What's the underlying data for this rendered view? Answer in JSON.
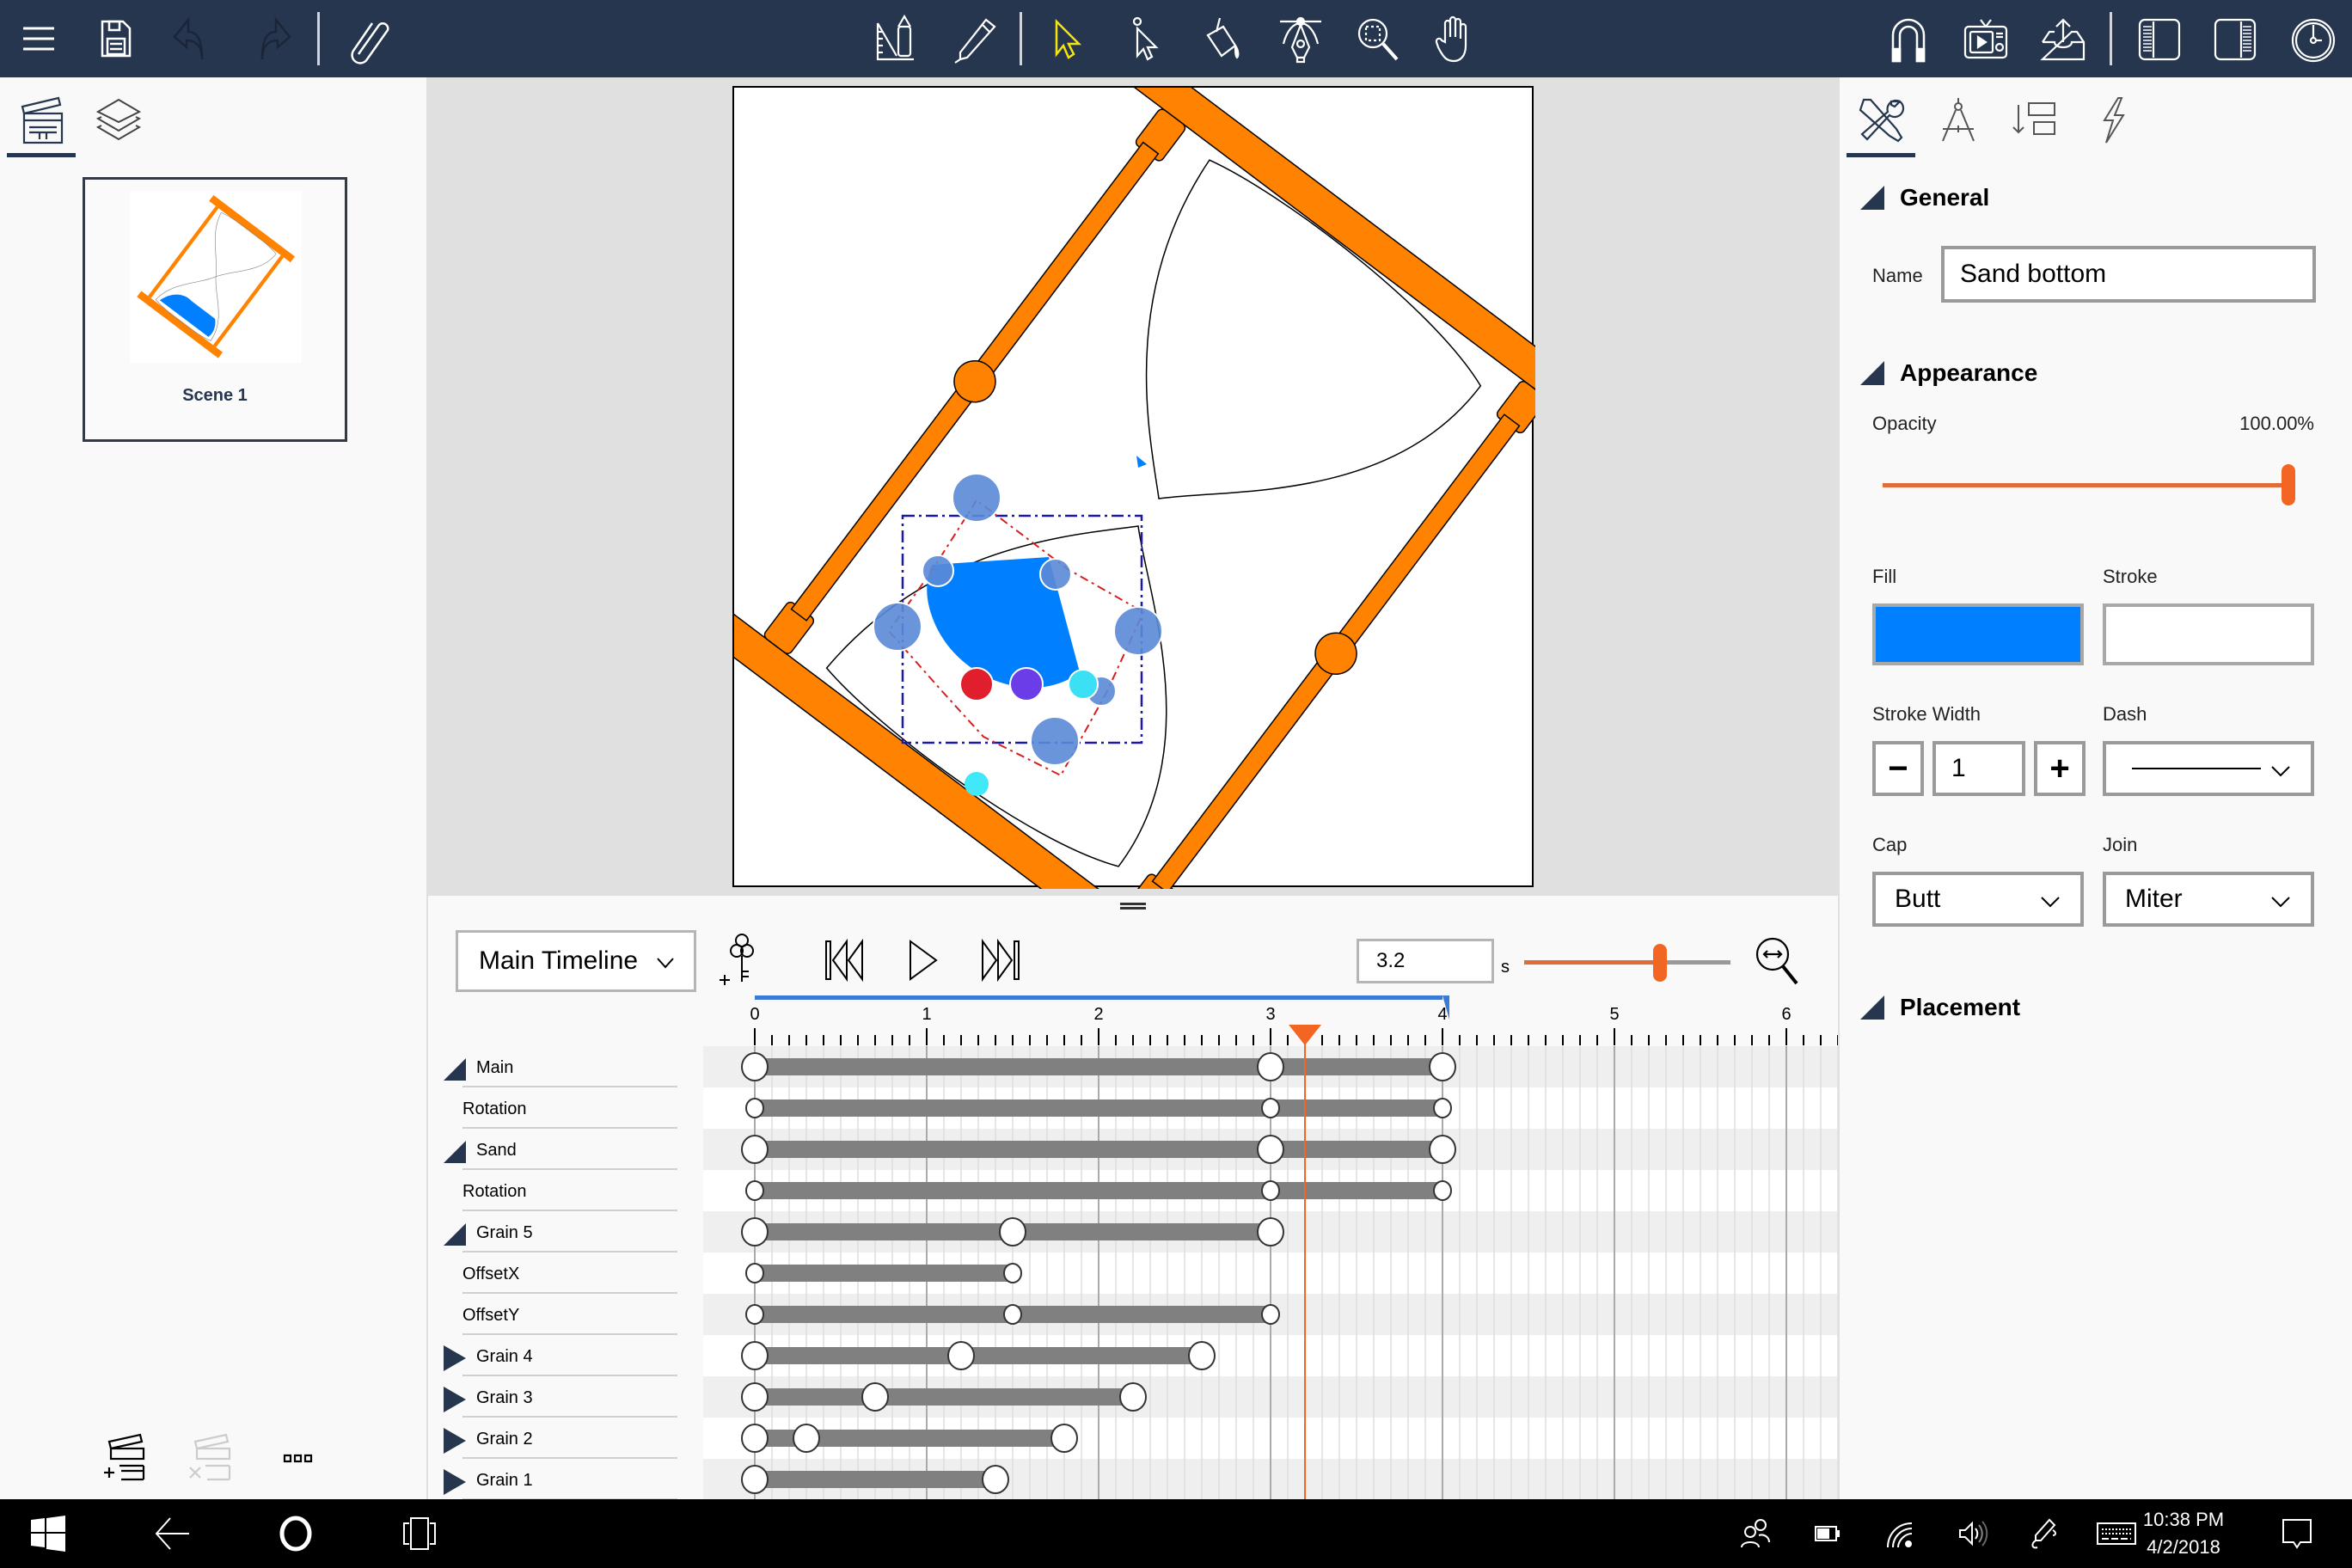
{
  "toolbar": {
    "left_icons": [
      "menu-icon",
      "save-icon",
      "undo-icon",
      "redo-icon",
      "attach-icon"
    ],
    "center_icons": [
      "design-tools-icon",
      "pen-icon",
      "select-icon",
      "direct-select-icon",
      "fill-bucket-icon",
      "bezier-pen-icon",
      "zoom-select-icon",
      "pan-hand-icon"
    ],
    "right_icons": [
      "magnet-snap-icon",
      "preview-tv-icon",
      "export-icon",
      "left-panel-toggle-icon",
      "right-panel-toggle-icon",
      "timeline-clock-icon"
    ],
    "active_tool": "select",
    "active_tool_color": "#f5e50a"
  },
  "left_panel": {
    "tabs": [
      "scenes",
      "layers"
    ],
    "active_tab": "scenes",
    "scenes": [
      {
        "label": "Scene 1"
      }
    ],
    "bottom_actions": [
      "add-scene",
      "delete-scene",
      "more"
    ],
    "more_label": "▫▫▫"
  },
  "canvas": {
    "selected_object": "Sand bottom",
    "colors": {
      "frame": "#ff8200",
      "sand": "#0080ff",
      "handle": "#5b8ad6",
      "grain_red": "#e01e2e",
      "grain_purple": "#6a3de8",
      "grain_cyan": "#3ce0f5",
      "selection_box": "#1a1aa8",
      "path_guide": "#d42020"
    }
  },
  "timeline": {
    "selector_value": "Main Timeline",
    "current_time": "3.2",
    "time_unit": "s",
    "zoom_level": 0.6,
    "ruler_labels": [
      "0",
      "1",
      "2",
      "3",
      "4",
      "5",
      "6"
    ],
    "ticks_per_second": 10,
    "playhead_seconds": 3.2,
    "work_area_end_seconds": 4.0,
    "tracks": [
      {
        "label": "Main",
        "kind": "group-expanded",
        "indent": 0,
        "keys": [
          0,
          3,
          4
        ],
        "big": true
      },
      {
        "label": "Rotation",
        "kind": "property",
        "indent": 1,
        "keys": [
          0,
          3,
          4
        ],
        "big": false
      },
      {
        "label": "Sand",
        "kind": "group-expanded",
        "indent": 0,
        "keys": [
          0,
          3,
          4
        ],
        "big": true
      },
      {
        "label": "Rotation",
        "kind": "property",
        "indent": 1,
        "keys": [
          0,
          3,
          4
        ],
        "big": false
      },
      {
        "label": "Grain 5",
        "kind": "group-expanded",
        "indent": 0,
        "keys": [
          0,
          1.5,
          3
        ],
        "big": true
      },
      {
        "label": "OffsetX",
        "kind": "property",
        "indent": 1,
        "keys": [
          0,
          1.5
        ],
        "big": false
      },
      {
        "label": "OffsetY",
        "kind": "property",
        "indent": 1,
        "keys": [
          0,
          1.5,
          3
        ],
        "big": false
      },
      {
        "label": "Grain 4",
        "kind": "group-collapsed",
        "indent": 0,
        "keys": [
          0,
          1.2,
          2.6
        ],
        "big": true
      },
      {
        "label": "Grain 3",
        "kind": "group-collapsed",
        "indent": 0,
        "keys": [
          0,
          0.7,
          2.2
        ],
        "big": true
      },
      {
        "label": "Grain 2",
        "kind": "group-collapsed",
        "indent": 0,
        "keys": [
          0,
          0.3,
          1.8
        ],
        "big": true
      },
      {
        "label": "Grain 1",
        "kind": "group-collapsed",
        "indent": 0,
        "keys": [
          0,
          1.4
        ],
        "big": true
      }
    ]
  },
  "properties": {
    "tabs": [
      "tools-properties",
      "geometry",
      "arrange",
      "animation"
    ],
    "active_tab": "tools-properties",
    "general": {
      "title": "General",
      "name_label": "Name",
      "name_value": "Sand bottom"
    },
    "appearance": {
      "title": "Appearance",
      "opacity_label": "Opacity",
      "opacity_value": "100.00%",
      "opacity_fraction": 1.0,
      "fill_label": "Fill",
      "fill_color": "#0080ff",
      "stroke_label": "Stroke",
      "stroke_color": "#ffffff",
      "stroke_width_label": "Stroke Width",
      "stroke_width_value": "1",
      "minus_label": "−",
      "plus_label": "+",
      "dash_label": "Dash",
      "dash_value": "solid",
      "cap_label": "Cap",
      "cap_value": "Butt",
      "join_label": "Join",
      "join_value": "Miter"
    },
    "placement": {
      "title": "Placement"
    }
  },
  "taskbar": {
    "time": "10:38 PM",
    "date": "4/2/2018",
    "tray_icons": [
      "people-icon",
      "battery-icon",
      "wifi-icon",
      "volume-icon",
      "pen-workspace-icon",
      "touch-keyboard-icon",
      "action-center-icon"
    ]
  }
}
